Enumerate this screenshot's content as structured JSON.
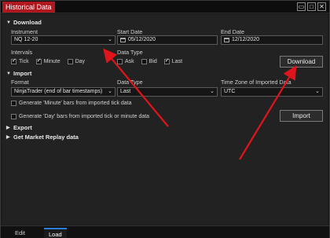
{
  "window": {
    "title": "Historical Data",
    "controls": [
      "▭",
      "□",
      "✕"
    ]
  },
  "download": {
    "header": "Download",
    "instrument_label": "Instrument",
    "instrument_value": "NQ 12-20",
    "start_label": "Start Date",
    "start_value": "05/12/2020",
    "end_label": "End Date",
    "end_value": "12/12/2020",
    "intervals_label": "Intervals",
    "intervals": [
      {
        "label": "Tick",
        "checked": true
      },
      {
        "label": "Minute",
        "checked": true
      },
      {
        "label": "Day",
        "checked": false
      }
    ],
    "datatype_label": "Data Type",
    "datatypes": [
      {
        "label": "Ask",
        "checked": false
      },
      {
        "label": "Bid",
        "checked": false
      },
      {
        "label": "Last",
        "checked": true
      }
    ],
    "button": "Download"
  },
  "import": {
    "header": "Import",
    "format_label": "Format",
    "format_value": "NinjaTrader (end of bar timestamps)",
    "datatype_label": "Data Type",
    "datatype_value": "Last",
    "timezone_label": "Time Zone of Imported Data",
    "timezone_value": "UTC",
    "option_minute": "Generate 'Minute' bars from imported tick data",
    "option_day": "Generate 'Day' bars from imported tick or minute data",
    "button": "Import"
  },
  "export": {
    "header": "Export"
  },
  "replay": {
    "header": "Get Market Replay data"
  },
  "tabs": [
    {
      "label": "Edit",
      "active": false
    },
    {
      "label": "Load",
      "active": true
    }
  ],
  "colors": {
    "title_tab": "#b01820",
    "arrow": "#e0141b",
    "tab_accent": "#2a7fd4"
  }
}
